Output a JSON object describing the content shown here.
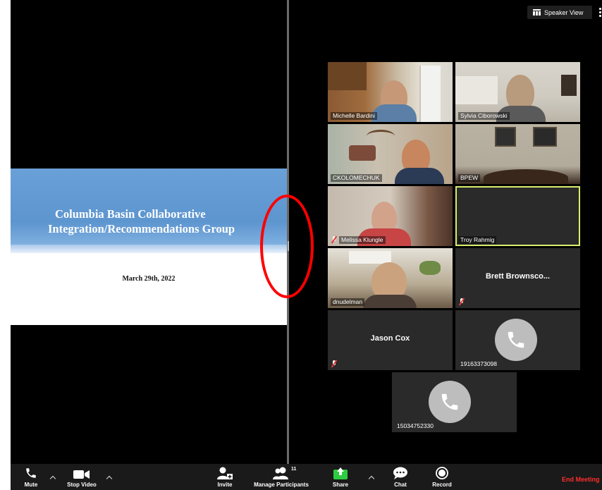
{
  "slide": {
    "title_line1": "Columbia Basin Collaborative",
    "title_line2": "Integration/Recommendations Group",
    "date": "March 29th, 2022"
  },
  "view": {
    "speaker_view_label": "Speaker View"
  },
  "participants": [
    {
      "name": "Michelle Bardini",
      "video": true,
      "muted": false
    },
    {
      "name": "Sylvia Ciborowski",
      "video": true,
      "muted": false
    },
    {
      "name": "CKOLOMECHUK",
      "video": true,
      "muted": false
    },
    {
      "name": "BPEW",
      "video": true,
      "muted": false
    },
    {
      "name": "Melissa Klungle",
      "video": true,
      "muted": true
    },
    {
      "name": "Troy Rahmig",
      "video": true,
      "muted": false,
      "active_speaker": true
    },
    {
      "name": "dnudelman",
      "video": true,
      "muted": false
    },
    {
      "name": "Brett Brownsco...",
      "video": false,
      "muted": true
    },
    {
      "name": "Jason Cox",
      "video": false,
      "muted": true
    },
    {
      "name": "19163373098",
      "video": false,
      "phone": true
    },
    {
      "name": "15034752330",
      "video": false,
      "phone": true
    }
  ],
  "toolbar": {
    "mute_label": "Mute",
    "stop_video_label": "Stop Video",
    "invite_label": "Invite",
    "manage_participants_label": "Manage Participants",
    "participant_count": "11",
    "share_label": "Share",
    "chat_label": "Chat",
    "record_label": "Record",
    "end_meeting_label": "End Meeting"
  },
  "colors": {
    "active_speaker_border": "#d7ee6c",
    "end_meeting": "#ff2d2d",
    "share_icon": "#2ecc40",
    "slide_banner": "#5d95cf",
    "annotation": "#ff0000"
  }
}
